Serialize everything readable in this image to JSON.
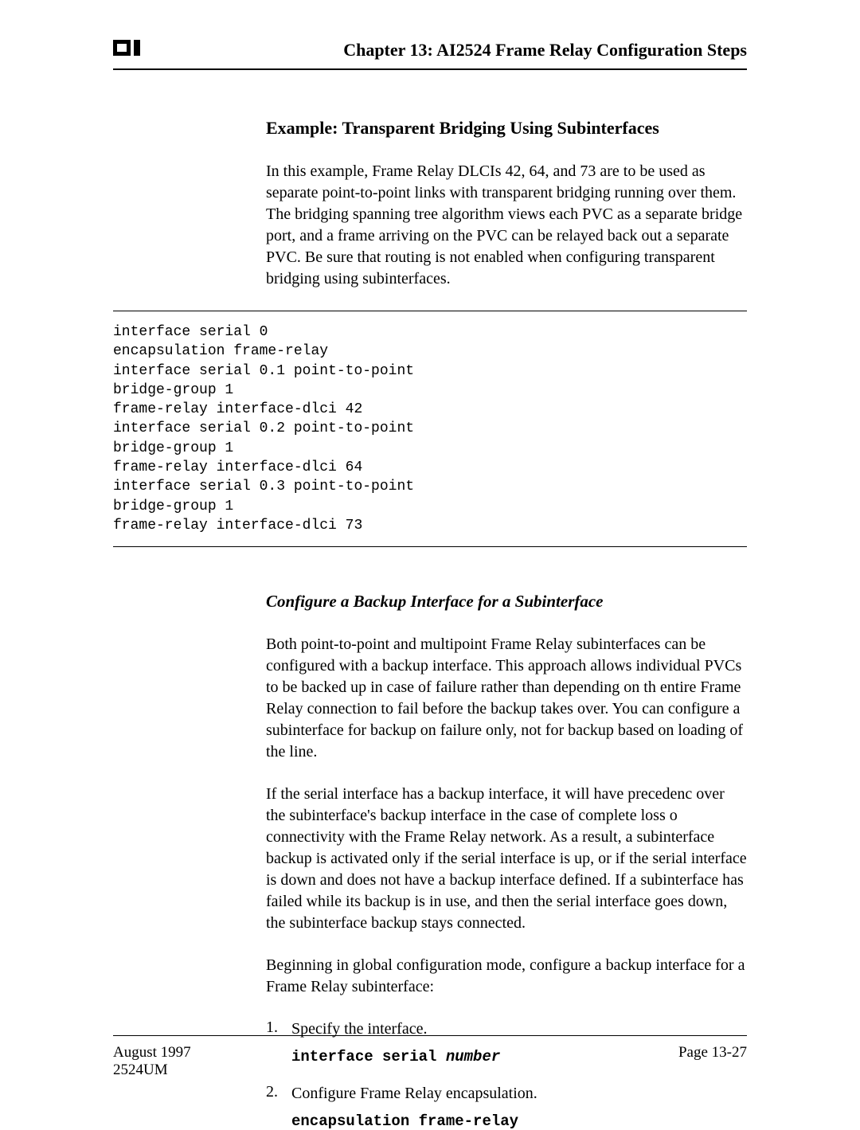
{
  "header": {
    "chapter_title": "Chapter 13: AI2524 Frame Relay Configuration Steps"
  },
  "section1": {
    "heading": "Example: Transparent Bridging Using Subinterfaces",
    "para": "In this example, Frame Relay DLCIs 42, 64, and 73 are to be used as separate point-to-point links with transparent bridging running over them. The bridging spanning tree algorithm views each PVC as a separate bridge port, and a frame arriving on the PVC can be relayed back out a separate PVC. Be sure that routing is not enabled when configuring transparent bridging using subinterfaces."
  },
  "code_block": "interface serial 0\nencapsulation frame-relay\ninterface serial 0.1 point-to-point\nbridge-group 1\nframe-relay interface-dlci 42\ninterface serial 0.2 point-to-point\nbridge-group 1\nframe-relay interface-dlci 64\ninterface serial 0.3 point-to-point\nbridge-group 1\nframe-relay interface-dlci 73",
  "section2": {
    "heading": "Configure a Backup Interface for a Subinterface",
    "para1": "Both point-to-point and multipoint Frame Relay subinterfaces can be configured with a backup interface. This approach allows individual PVCs to be backed up in case of failure rather than depending on th entire Frame Relay connection to fail before the backup takes over. You can configure a subinterface for backup on failure only, not for backup based on loading of the line.",
    "para2": "If the serial interface has a backup interface, it will have precedenc over the subinterface's backup interface in the case of complete loss o connectivity with the Frame Relay network. As a result, a subinterface backup is activated only if the serial interface is up, or if the serial interface is down and does not have a backup interface defined. If a subinterface has failed while its backup is in use, and then the serial interface goes down, the subinterface backup stays connected.",
    "para3": "Beginning in global configuration mode, configure a backup interface for a Frame Relay subinterface:",
    "steps": [
      {
        "num": "1.",
        "text": "Specify the interface.",
        "cmd_bold": "interface serial ",
        "cmd_param": "number"
      },
      {
        "num": "2.",
        "text": "Configure Frame Relay encapsulation.",
        "cmd_bold": "encapsulation frame-relay",
        "cmd_param": ""
      }
    ]
  },
  "footer": {
    "date": "August 1997",
    "doc_id": "2524UM",
    "page": "Page 13-27"
  }
}
